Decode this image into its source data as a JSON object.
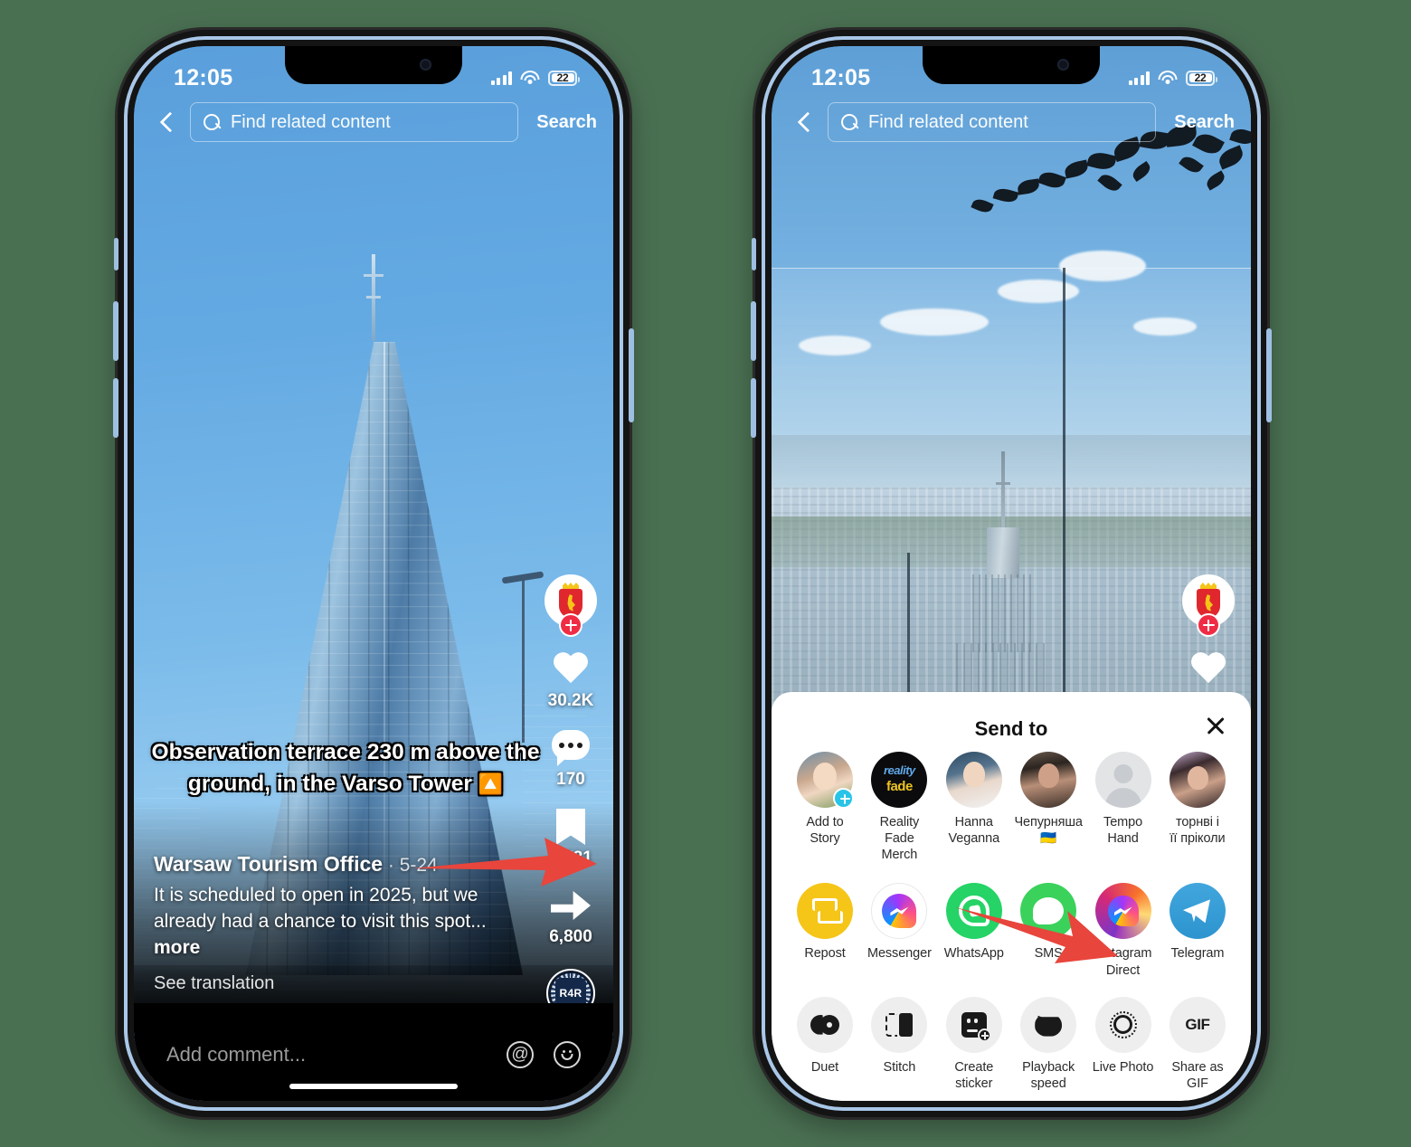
{
  "background_color": "#4a7052",
  "accent_arrow_color": "#e8453c",
  "phones": {
    "left": {
      "status_bar": {
        "time": "12:05",
        "battery_level": "22",
        "wifi_icon": "wifi-icon",
        "signal_icon": "cellular-signal-icon"
      },
      "header": {
        "back_icon": "back-chevron-icon",
        "search_icon": "search-icon",
        "search_placeholder": "Find related content",
        "search_button": "Search"
      },
      "video_overlay_caption": "Observation terrace 230 m above the ground, in the Varso Tower",
      "caption_emoji": "🔼",
      "actions": {
        "avatar_icon": "profile-avatar-crest-icon",
        "follow_icon": "follow-plus-icon",
        "like": {
          "icon": "heart-icon",
          "count": "30.2K"
        },
        "comment": {
          "icon": "comment-bubble-icon",
          "count": "170"
        },
        "bookmark": {
          "icon": "bookmark-icon",
          "count": "8,581"
        },
        "share": {
          "icon": "share-arrow-icon",
          "count": "6,800"
        },
        "music_disc": {
          "icon": "music-disc-icon",
          "label": "R4R"
        }
      },
      "meta": {
        "author": "Warsaw Tourism Office",
        "separator": "·",
        "date": "5-24",
        "description": "It is scheduled to open in 2025, but we already had a chance to visit this spot...",
        "more_label": "more",
        "translate_label": "See translation"
      },
      "comment_bar": {
        "placeholder": "Add comment...",
        "mention_icon": "at-mention-icon",
        "emoji_icon": "emoji-smiley-icon"
      }
    },
    "right": {
      "status_bar": {
        "time": "12:05",
        "battery_level": "22",
        "wifi_icon": "wifi-icon",
        "signal_icon": "cellular-signal-icon"
      },
      "header": {
        "back_icon": "back-chevron-icon",
        "search_icon": "search-icon",
        "search_placeholder": "Find related content",
        "search_button": "Search"
      },
      "actions": {
        "avatar_icon": "profile-avatar-crest-icon",
        "follow_icon": "follow-plus-icon",
        "like": {
          "icon": "heart-icon"
        }
      },
      "share_sheet": {
        "title": "Send to",
        "close_icon": "close-x-icon",
        "contacts": [
          {
            "label": "Add to\nStory",
            "label_l1": "Add to",
            "label_l2": "Story",
            "icon": "add-to-story-avatar",
            "badge": "plus-badge"
          },
          {
            "label_l1": "Reality",
            "label_l2": "Fade Merch",
            "icon": "contact-avatar"
          },
          {
            "label_l1": "Hanna",
            "label_l2": "Veganna",
            "icon": "contact-avatar"
          },
          {
            "label_l1": "Чепурняша",
            "label_l2": "🇺🇦",
            "icon": "contact-avatar"
          },
          {
            "label_l1": "Tempo",
            "label_l2": "Hand",
            "icon": "contact-avatar-placeholder"
          },
          {
            "label_l1": "торнві і",
            "label_l2": "її пріколи",
            "icon": "contact-avatar"
          }
        ],
        "apps": [
          {
            "label": "Repost",
            "icon": "repost-icon",
            "color": "#f5c518"
          },
          {
            "label": "Messenger",
            "icon": "messenger-icon",
            "color": "#ffffff"
          },
          {
            "label": "WhatsApp",
            "icon": "whatsapp-icon",
            "color": "#25d366"
          },
          {
            "label": "SMS",
            "icon": "sms-icon",
            "color": "#3ad25b"
          },
          {
            "label_l1": "Instagram",
            "label_l2": "Direct",
            "label": "Instagram Direct",
            "icon": "instagram-direct-icon",
            "color": "#d62976"
          },
          {
            "label": "Telegram",
            "icon": "telegram-icon",
            "color": "#34a2db"
          }
        ],
        "actions": [
          {
            "label": "Duet",
            "icon": "duet-icon"
          },
          {
            "label": "Stitch",
            "icon": "stitch-icon"
          },
          {
            "label_l1": "Create",
            "label_l2": "sticker",
            "label": "Create sticker",
            "icon": "create-sticker-icon"
          },
          {
            "label_l1": "Playback",
            "label_l2": "speed",
            "label": "Playback speed",
            "icon": "playback-speed-icon"
          },
          {
            "label": "Live Photo",
            "icon": "live-photo-icon"
          },
          {
            "label": "Share as GIF",
            "icon": "gif-icon"
          }
        ]
      }
    }
  },
  "annotations": [
    {
      "name": "arrow-to-share-button",
      "color": "#e8453c",
      "direction": "right"
    },
    {
      "name": "arrow-to-live-photo",
      "color": "#e8453c",
      "direction": "down-right"
    }
  ]
}
